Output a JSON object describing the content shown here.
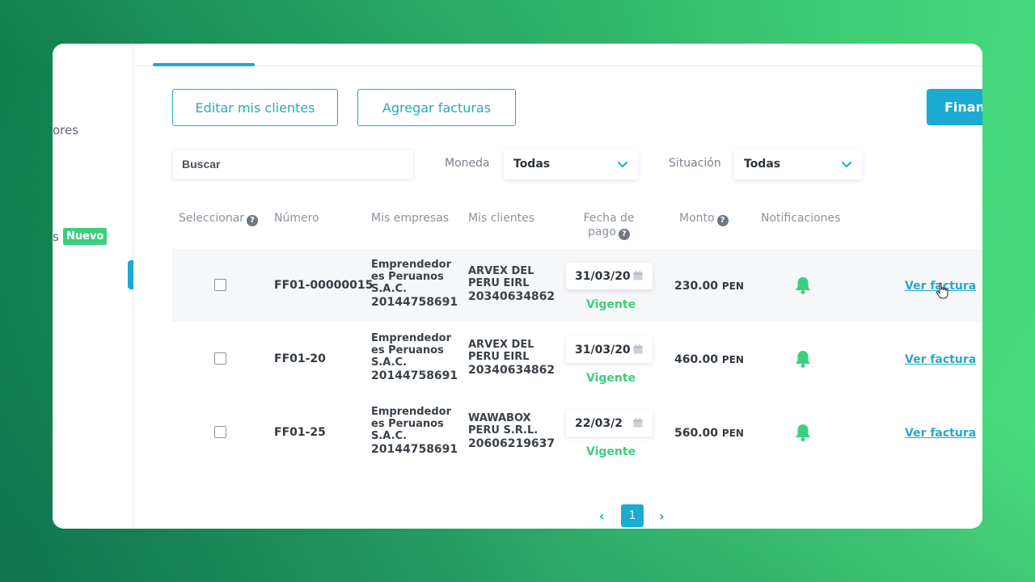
{
  "sidebar": {
    "item_fragment_1": "ores",
    "item_fragment_2": "s",
    "badge": "Nuevo"
  },
  "toolbar": {
    "edit_clients": "Editar mis clientes",
    "add_invoices": "Agregar facturas",
    "finance": "Finan"
  },
  "filters": {
    "search_placeholder": "Buscar",
    "currency_label": "Moneda",
    "currency_value": "Todas",
    "status_label": "Situación",
    "status_value": "Todas"
  },
  "table": {
    "headers": {
      "select": "Seleccionar",
      "number": "Número",
      "companies": "Mis empresas",
      "clients": "Mis clientes",
      "payment_date_line1": "Fecha de",
      "payment_date_line2": "pago",
      "amount": "Monto",
      "notifications": "Notificaciones"
    },
    "rows": [
      {
        "number": "FF01-00000015",
        "company_line1": "Emprendedor",
        "company_line2": "es Peruanos",
        "company_line3": "S.A.C.",
        "company_id": "20144758691",
        "client_line1": "ARVEX DEL",
        "client_line2": "PERU EIRL",
        "client_id": "20340634862",
        "date": "31/03/20",
        "status": "Vigente",
        "amount": "230.00",
        "currency": "PEN",
        "link": "Ver factura"
      },
      {
        "number": "FF01-20",
        "company_line1": "Emprendedor",
        "company_line2": "es Peruanos",
        "company_line3": "S.A.C.",
        "company_id": "20144758691",
        "client_line1": "ARVEX DEL",
        "client_line2": "PERU EIRL",
        "client_id": "20340634862",
        "date": "31/03/20",
        "status": "Vigente",
        "amount": "460.00",
        "currency": "PEN",
        "link": "Ver factura"
      },
      {
        "number": "FF01-25",
        "company_line1": "Emprendedor",
        "company_line2": "es Peruanos",
        "company_line3": "S.A.C.",
        "company_id": "20144758691",
        "client_line1": "WAWABOX",
        "client_line2": "PERU S.R.L.",
        "client_id": "20606219637",
        "date": "22/03/2",
        "status": "Vigente",
        "amount": "560.00",
        "currency": "PEN",
        "link": "Ver factura"
      }
    ]
  },
  "pagination": {
    "prev": "‹",
    "current": "1",
    "next": "›"
  },
  "colors": {
    "accent": "#1aaad2",
    "success": "#3ccf7e",
    "outline": "#2aa8b8"
  }
}
